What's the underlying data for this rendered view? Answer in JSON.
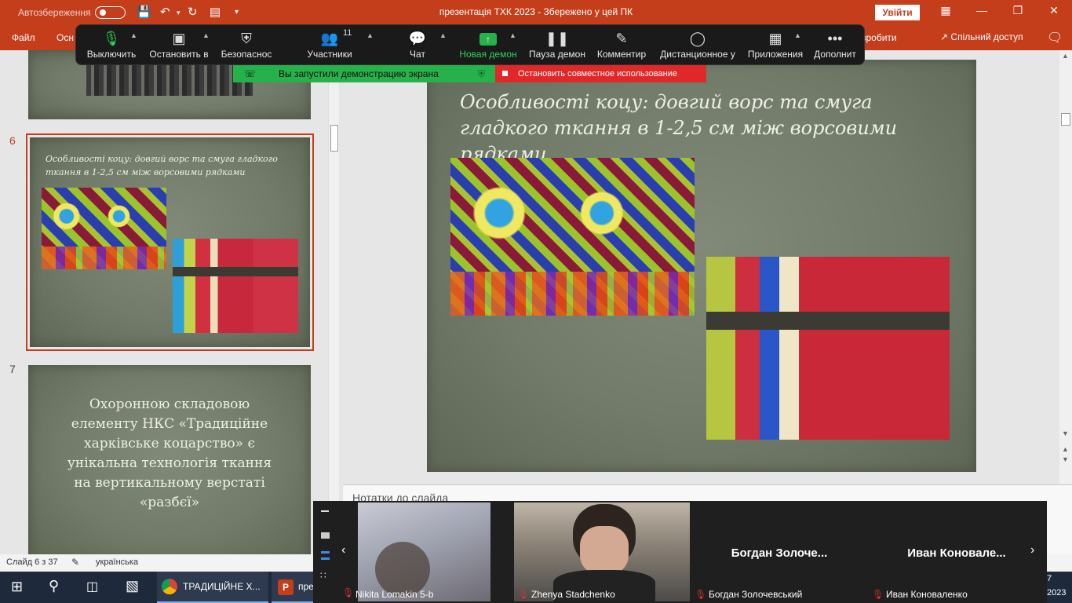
{
  "titlebar": {
    "autosave_label": "Автозбереження",
    "document_title": "презентація ТХК 2023  -  Збережено у цей ПК",
    "signin_label": "Увійти"
  },
  "ribbon": {
    "file": "Файл",
    "home": "Осн",
    "record": "зробити",
    "share": "Спільний доступ"
  },
  "zoom_toolbar": {
    "mute": "Выключить",
    "stop_video": "Остановить в",
    "security": "Безопаснос",
    "participants": "Участники",
    "participants_count": "11",
    "chat": "Чат",
    "new_share": "Новая демон",
    "pause_share": "Пауза демон",
    "annotate": "Комментир",
    "remote_control": "Дистанционное у",
    "apps": "Приложения",
    "more": "Дополнит"
  },
  "share_banner": {
    "status": "Вы запустили демонстрацию экрана",
    "stop": "Остановить совместное использование"
  },
  "thumbnails": [
    {
      "number": "6",
      "title": "Особливості коцу: довгий ворс та смуга гладкого ткання в 1-2,5 см між ворсовими рядками"
    },
    {
      "number": "7",
      "text": "Охоронною складовою елементу НКС «Традиційне харківське коцарство» є унікальна технологія ткання на  вертикальному верстаті «разбєї»"
    }
  ],
  "slide": {
    "title": "Особливості коцу: довгий ворс та смуга гладкого ткання в 1-2,5 см між ворсовими рядками"
  },
  "notes": {
    "label": "Нотатки до слайда"
  },
  "statusbar": {
    "slide_counter": "Слайд 6 з 37",
    "language": "українська"
  },
  "taskbar": {
    "chrome_label": "ТРАДИЦІЙНЕ Х...",
    "ppt_label": "пре",
    "clock_time": "7",
    "clock_year": "2023"
  },
  "video_strip": {
    "participants": [
      {
        "name": "Nikita Lomakin 5-b"
      },
      {
        "name": "Zhenya Stadchenko"
      },
      {
        "display": "Богдан  Золоче...",
        "name": "Богдан Золочевський"
      },
      {
        "display": "Иван  Коновале...",
        "name": "Иван Коноваленко"
      }
    ]
  },
  "colors": {
    "accent": "#c43e1c",
    "zoom_toolbar": "#1a1a1a",
    "share_green": "#27b14b",
    "stop_red": "#e02828"
  }
}
